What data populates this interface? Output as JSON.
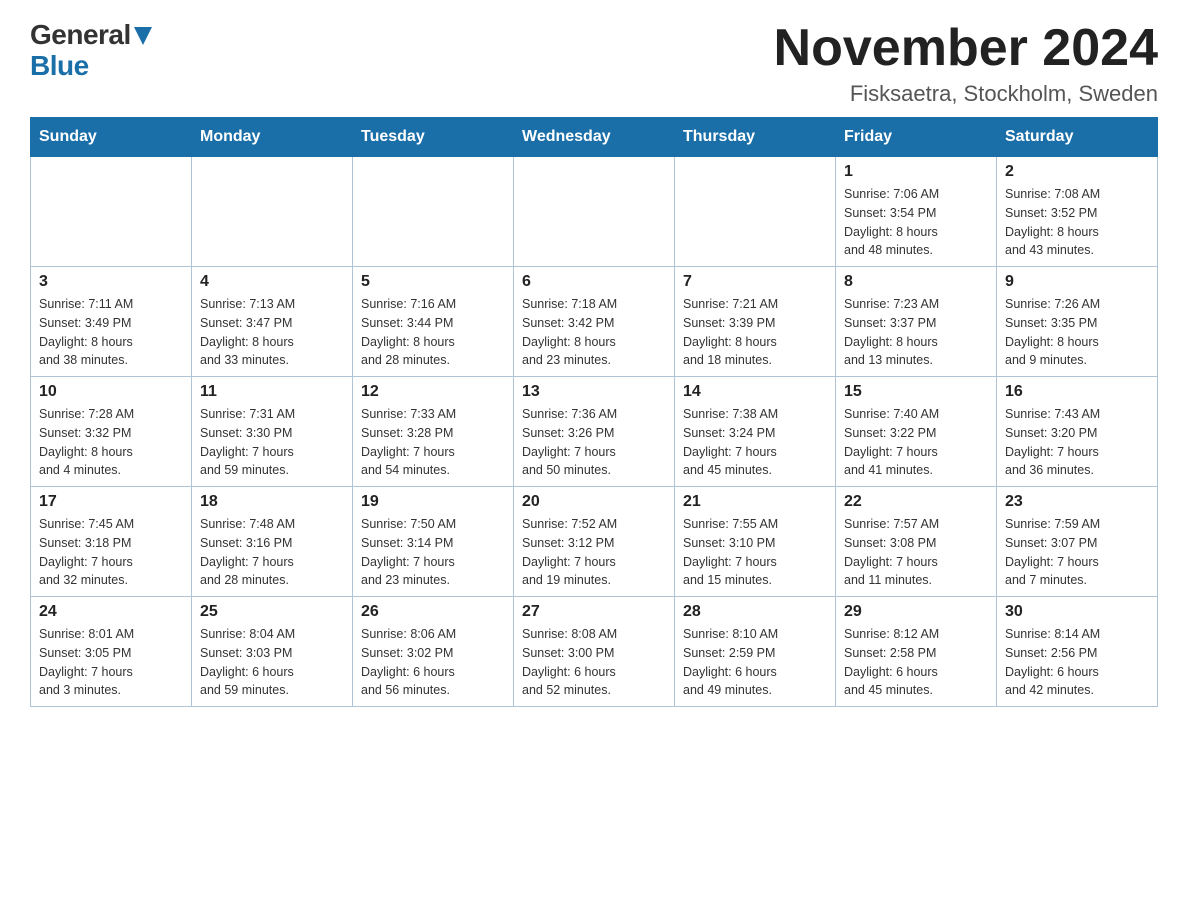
{
  "logo": {
    "general": "General",
    "blue": "Blue"
  },
  "title": {
    "month": "November 2024",
    "location": "Fisksaetra, Stockholm, Sweden"
  },
  "weekdays": [
    "Sunday",
    "Monday",
    "Tuesday",
    "Wednesday",
    "Thursday",
    "Friday",
    "Saturday"
  ],
  "weeks": [
    [
      {
        "day": "",
        "info": ""
      },
      {
        "day": "",
        "info": ""
      },
      {
        "day": "",
        "info": ""
      },
      {
        "day": "",
        "info": ""
      },
      {
        "day": "",
        "info": ""
      },
      {
        "day": "1",
        "info": "Sunrise: 7:06 AM\nSunset: 3:54 PM\nDaylight: 8 hours\nand 48 minutes."
      },
      {
        "day": "2",
        "info": "Sunrise: 7:08 AM\nSunset: 3:52 PM\nDaylight: 8 hours\nand 43 minutes."
      }
    ],
    [
      {
        "day": "3",
        "info": "Sunrise: 7:11 AM\nSunset: 3:49 PM\nDaylight: 8 hours\nand 38 minutes."
      },
      {
        "day": "4",
        "info": "Sunrise: 7:13 AM\nSunset: 3:47 PM\nDaylight: 8 hours\nand 33 minutes."
      },
      {
        "day": "5",
        "info": "Sunrise: 7:16 AM\nSunset: 3:44 PM\nDaylight: 8 hours\nand 28 minutes."
      },
      {
        "day": "6",
        "info": "Sunrise: 7:18 AM\nSunset: 3:42 PM\nDaylight: 8 hours\nand 23 minutes."
      },
      {
        "day": "7",
        "info": "Sunrise: 7:21 AM\nSunset: 3:39 PM\nDaylight: 8 hours\nand 18 minutes."
      },
      {
        "day": "8",
        "info": "Sunrise: 7:23 AM\nSunset: 3:37 PM\nDaylight: 8 hours\nand 13 minutes."
      },
      {
        "day": "9",
        "info": "Sunrise: 7:26 AM\nSunset: 3:35 PM\nDaylight: 8 hours\nand 9 minutes."
      }
    ],
    [
      {
        "day": "10",
        "info": "Sunrise: 7:28 AM\nSunset: 3:32 PM\nDaylight: 8 hours\nand 4 minutes."
      },
      {
        "day": "11",
        "info": "Sunrise: 7:31 AM\nSunset: 3:30 PM\nDaylight: 7 hours\nand 59 minutes."
      },
      {
        "day": "12",
        "info": "Sunrise: 7:33 AM\nSunset: 3:28 PM\nDaylight: 7 hours\nand 54 minutes."
      },
      {
        "day": "13",
        "info": "Sunrise: 7:36 AM\nSunset: 3:26 PM\nDaylight: 7 hours\nand 50 minutes."
      },
      {
        "day": "14",
        "info": "Sunrise: 7:38 AM\nSunset: 3:24 PM\nDaylight: 7 hours\nand 45 minutes."
      },
      {
        "day": "15",
        "info": "Sunrise: 7:40 AM\nSunset: 3:22 PM\nDaylight: 7 hours\nand 41 minutes."
      },
      {
        "day": "16",
        "info": "Sunrise: 7:43 AM\nSunset: 3:20 PM\nDaylight: 7 hours\nand 36 minutes."
      }
    ],
    [
      {
        "day": "17",
        "info": "Sunrise: 7:45 AM\nSunset: 3:18 PM\nDaylight: 7 hours\nand 32 minutes."
      },
      {
        "day": "18",
        "info": "Sunrise: 7:48 AM\nSunset: 3:16 PM\nDaylight: 7 hours\nand 28 minutes."
      },
      {
        "day": "19",
        "info": "Sunrise: 7:50 AM\nSunset: 3:14 PM\nDaylight: 7 hours\nand 23 minutes."
      },
      {
        "day": "20",
        "info": "Sunrise: 7:52 AM\nSunset: 3:12 PM\nDaylight: 7 hours\nand 19 minutes."
      },
      {
        "day": "21",
        "info": "Sunrise: 7:55 AM\nSunset: 3:10 PM\nDaylight: 7 hours\nand 15 minutes."
      },
      {
        "day": "22",
        "info": "Sunrise: 7:57 AM\nSunset: 3:08 PM\nDaylight: 7 hours\nand 11 minutes."
      },
      {
        "day": "23",
        "info": "Sunrise: 7:59 AM\nSunset: 3:07 PM\nDaylight: 7 hours\nand 7 minutes."
      }
    ],
    [
      {
        "day": "24",
        "info": "Sunrise: 8:01 AM\nSunset: 3:05 PM\nDaylight: 7 hours\nand 3 minutes."
      },
      {
        "day": "25",
        "info": "Sunrise: 8:04 AM\nSunset: 3:03 PM\nDaylight: 6 hours\nand 59 minutes."
      },
      {
        "day": "26",
        "info": "Sunrise: 8:06 AM\nSunset: 3:02 PM\nDaylight: 6 hours\nand 56 minutes."
      },
      {
        "day": "27",
        "info": "Sunrise: 8:08 AM\nSunset: 3:00 PM\nDaylight: 6 hours\nand 52 minutes."
      },
      {
        "day": "28",
        "info": "Sunrise: 8:10 AM\nSunset: 2:59 PM\nDaylight: 6 hours\nand 49 minutes."
      },
      {
        "day": "29",
        "info": "Sunrise: 8:12 AM\nSunset: 2:58 PM\nDaylight: 6 hours\nand 45 minutes."
      },
      {
        "day": "30",
        "info": "Sunrise: 8:14 AM\nSunset: 2:56 PM\nDaylight: 6 hours\nand 42 minutes."
      }
    ]
  ]
}
